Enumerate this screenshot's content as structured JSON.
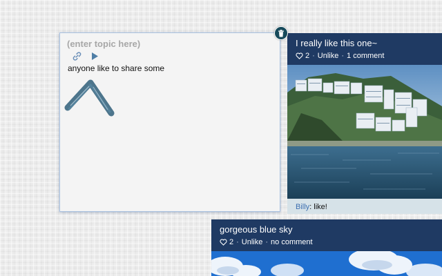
{
  "compose": {
    "topic_placeholder": "(enter topic here)",
    "body_text": "anyone like to share some"
  },
  "posts": [
    {
      "title": "I really like this one~",
      "likes": "2",
      "unlike_label": "Unlike",
      "comments_label": "1 comment",
      "comments": [
        {
          "author": "Billy",
          "text": ": like!"
        }
      ]
    },
    {
      "title": "gorgeous blue sky",
      "likes": "2",
      "unlike_label": "Unlike",
      "comments_label": "no comment"
    }
  ],
  "meta_separator": "·",
  "icons": {
    "compose_tools": [
      "link-icon",
      "play-icon"
    ],
    "delete": "trash-icon",
    "like": "heart-icon"
  },
  "colors": {
    "header_bg": "#1f3a63",
    "delete_bg": "#174a5b",
    "link_blue": "#3d6fb0",
    "comment_bg": "#d6e2e8"
  }
}
